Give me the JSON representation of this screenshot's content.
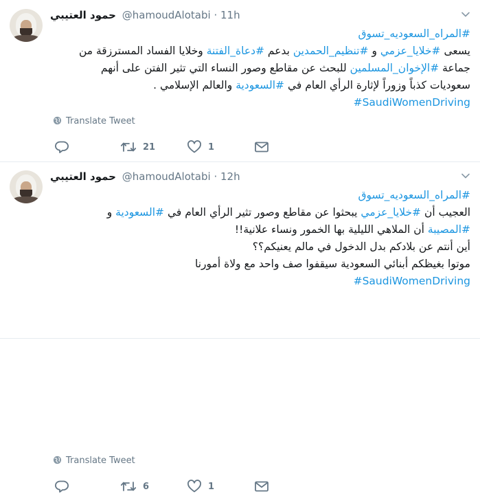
{
  "tweets": [
    {
      "name": "حمود العتيبي",
      "handle": "@hamoudAlotabi",
      "dot": "·",
      "time": "11h",
      "lines": [
        [
          {
            "t": "#المراه_السعوديه_تسوق",
            "tag": true
          }
        ],
        [
          {
            "t": "يسعى ",
            "tag": false
          },
          {
            "t": "#خلايا_عزمي",
            "tag": true
          },
          {
            "t": " و ",
            "tag": false
          },
          {
            "t": "#تنظيم_الحمدين",
            "tag": true
          },
          {
            "t": " بدعم ",
            "tag": false
          },
          {
            "t": "#دعاة_الفتنة",
            "tag": true
          },
          {
            "t": " وخلايا الفساد المسترزقة من",
            "tag": false
          }
        ],
        [
          {
            "t": "جماعة ",
            "tag": false
          },
          {
            "t": "#الإخوان_المسلمين",
            "tag": true
          },
          {
            "t": " للبحث عن مقاطع وصور النساء التي تثير الفتن على أنهم",
            "tag": false
          }
        ],
        [
          {
            "t": "سعوديات كذباً وزوراً لإثارة الرأي العام في ",
            "tag": false
          },
          {
            "t": "#السعودية",
            "tag": true
          },
          {
            "t": " والعالم الإسلامي .",
            "tag": false
          }
        ],
        [
          {
            "t": "#SaudiWomenDriving",
            "tag": true,
            "en": true
          }
        ]
      ],
      "translate": "Translate Tweet",
      "retweets": "21",
      "likes": "1"
    },
    {
      "name": "حمود العتيبي",
      "handle": "@hamoudAlotabi",
      "dot": "·",
      "time": "12h",
      "lines": [
        [
          {
            "t": "#المراه_السعوديه_تسوق",
            "tag": true
          }
        ],
        [
          {
            "t": "العجيب أن ",
            "tag": false
          },
          {
            "t": "#خلايا_عزمي",
            "tag": true
          },
          {
            "t": " يبحثوا عن مقاطع وصور تثير الرأي العام في  ",
            "tag": false
          },
          {
            "t": "#السعودية",
            "tag": true
          },
          {
            "t": " و",
            "tag": false
          }
        ],
        [
          {
            "t": "#المصيبة",
            "tag": true
          },
          {
            "t": " أن الملاهي الليلية بها الخمور ونساء علانية!!",
            "tag": false
          }
        ],
        [
          {
            "t": "أين أنتم عن بلادكم بدل الدخول في مالم يعنيكم؟؟",
            "tag": false
          }
        ],
        [
          {
            "t": "موتوا بغيظكم أبنائي السعودية سيقفوا صف واحد مع ولاة أمورنا",
            "tag": false
          }
        ],
        [
          {
            "t": "#SaudiWomenDriving",
            "tag": true,
            "en": true
          }
        ]
      ],
      "translate": "Translate Tweet",
      "retweets": "6",
      "likes": "1"
    }
  ],
  "icons": {
    "more": "chevron-down-icon",
    "translate": "globe-icon",
    "reply": "reply-icon",
    "retweet": "retweet-icon",
    "like": "heart-icon",
    "dm": "envelope-icon"
  },
  "colors": {
    "link": "#1b95e0",
    "muted": "#657786",
    "text": "#14171a",
    "divider": "#e6ecf0"
  }
}
